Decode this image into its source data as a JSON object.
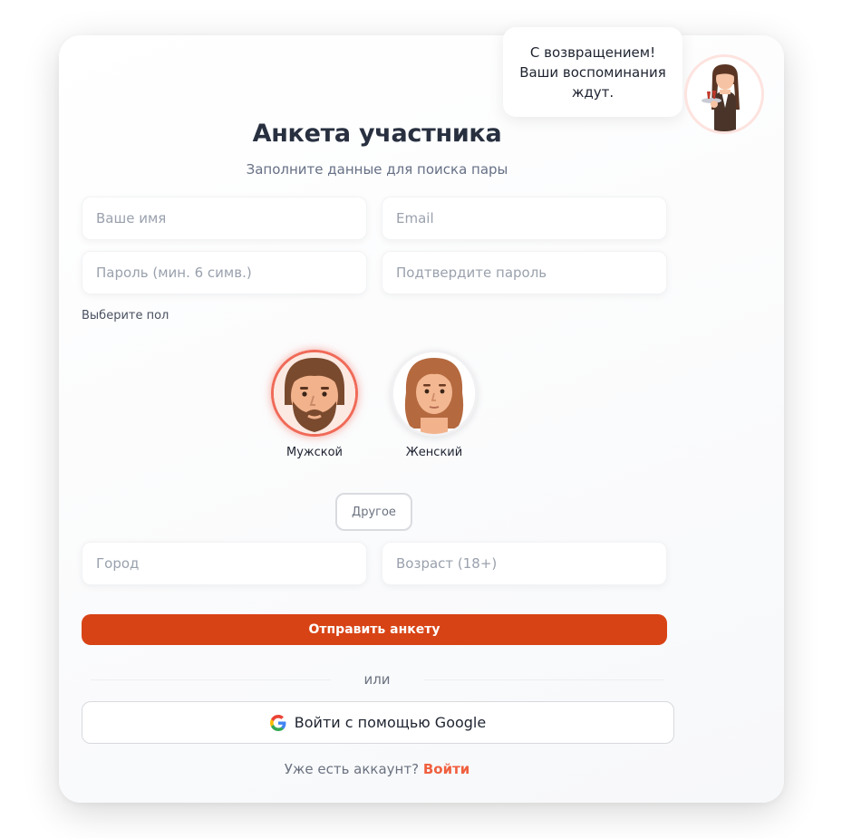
{
  "assistant": {
    "bubble_text": "С возвращением!\nВаши воспоминания\nждут."
  },
  "form": {
    "title": "Анкета участника",
    "subtitle": "Заполните данные для поиска пары",
    "name_placeholder": "Ваше имя",
    "email_placeholder": "Email",
    "password_placeholder": "Пароль (мин. 6 симв.)",
    "confirm_placeholder": "Подтвердите пароль",
    "gender_label": "Выберите пол",
    "genders": [
      {
        "label": "Мужской",
        "selected": true
      },
      {
        "label": "Женский",
        "selected": false
      }
    ],
    "other_gender_label": "Другое",
    "city_placeholder": "Город",
    "age_placeholder": "Возраст (18+)",
    "submit_label": "Отправить анкету",
    "divider_text": "или",
    "google_label": "Войти с помощью Google",
    "login_prompt": "Уже есть аккаунт?",
    "login_link": "Войти"
  },
  "colors": {
    "accent": "#d84315",
    "link": "#f0603f",
    "selected_ring": "#f06a58"
  }
}
